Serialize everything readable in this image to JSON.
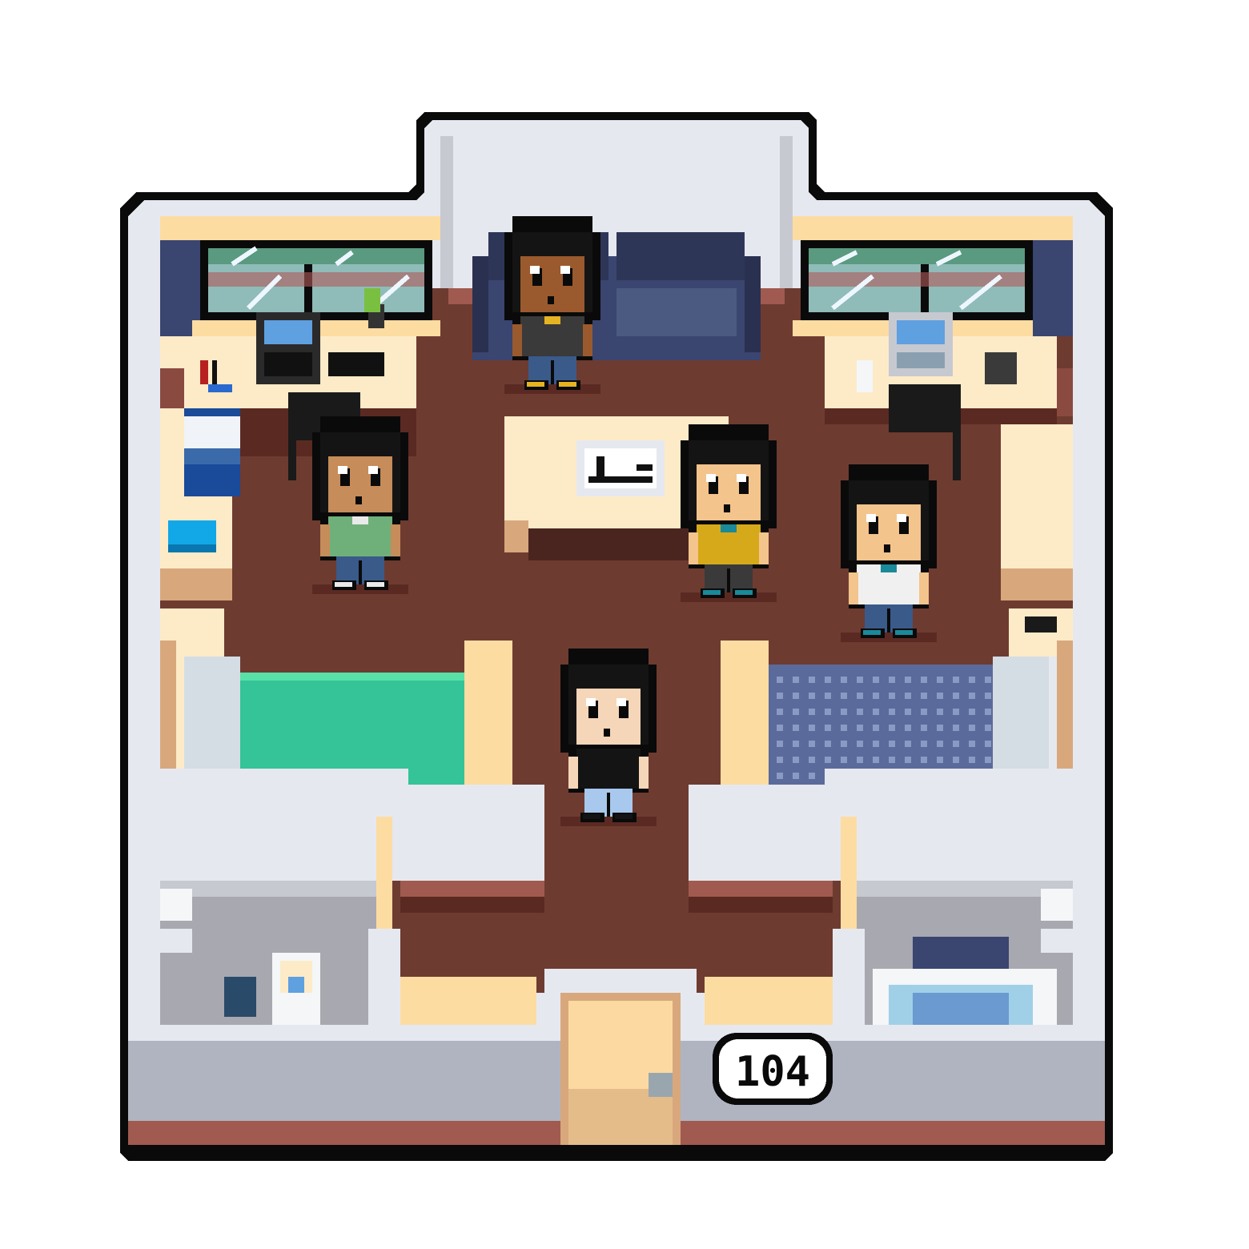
{
  "room": {
    "number": "104"
  },
  "characters": [
    {
      "id": "top-center",
      "skin": "#9a5a2e",
      "hair": "#141414",
      "shirt": "#3a3a3a",
      "pants": "#3a5a8a",
      "accent": "#e6b422"
    },
    {
      "id": "left-green",
      "skin": "#c68c5a",
      "hair": "#141414",
      "shirt": "#6fb07a",
      "pants": "#3a5a8a",
      "accent": "#eaeaea"
    },
    {
      "id": "center-yellow",
      "skin": "#f3c48c",
      "hair": "#141414",
      "shirt": "#d6a91a",
      "pants": "#3a3a3a",
      "accent": "#1a8a9a"
    },
    {
      "id": "right-striped",
      "skin": "#f3c48c",
      "hair": "#141414",
      "shirt": "#f0f0f0",
      "pants": "#3a5a8a",
      "accent": "#1a8a9a"
    },
    {
      "id": "bottom-center",
      "skin": "#f6d6b8",
      "hair": "#141414",
      "shirt": "#141414",
      "pants": "#a8c8ee",
      "accent": "#141414"
    }
  ],
  "colors": {
    "outline": "#0a0a0a",
    "wall": "#e6e8f0",
    "wall_shade": "#c7c9d1",
    "floor": "#6e3b30",
    "floor_dark": "#5a2a22",
    "wood_light": "#fdebc8",
    "wood_mid": "#fddca2",
    "wood_dark": "#d8a87c",
    "curtain": "#3a4570",
    "rug_green": "#34c497",
    "rug_blue": "#5a6a9a",
    "bathroom_floor": "#a8a8b0",
    "door": "#fbd9a0"
  }
}
